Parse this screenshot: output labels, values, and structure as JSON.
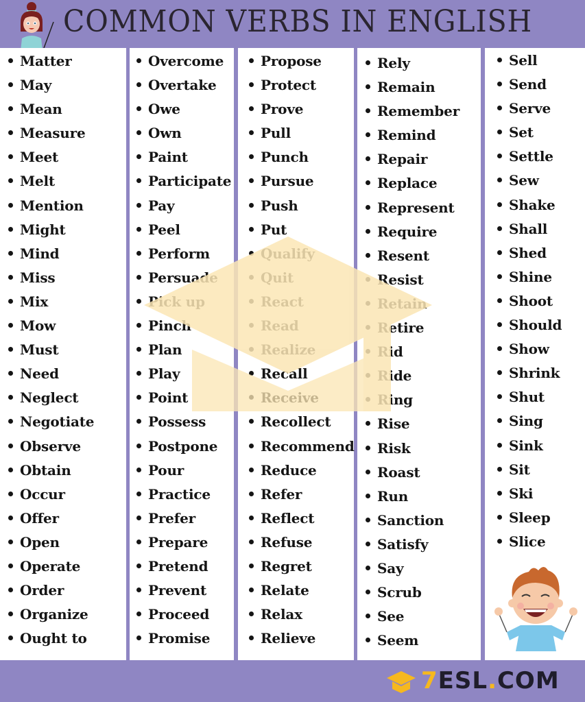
{
  "header": {
    "title": "COMMON VERBS IN ENGLISH",
    "illustration": "teacher-with-pointer"
  },
  "colors": {
    "frame": "#8f86c3",
    "panel": "#ffffff",
    "text": "#151515",
    "title": "#2a2530",
    "watermark": "#fbe6b5",
    "logo_accent": "#f6b81f",
    "logo_dark": "#1f1d2b"
  },
  "columns": [
    {
      "items": [
        "Matter",
        "May",
        "Mean",
        "Measure",
        "Meet",
        "Melt",
        "Mention",
        "Might",
        "Mind",
        "Miss",
        "Mix",
        "Mow",
        "Must",
        "Need",
        "Neglect",
        "Negotiate",
        "Observe",
        "Obtain",
        "Occur",
        "Offer",
        "Open",
        "Operate",
        "Order",
        "Organize",
        "Ought to"
      ]
    },
    {
      "items": [
        "Overcome",
        "Overtake",
        "Owe",
        "Own",
        "Paint",
        "Participate",
        "Pay",
        "Peel",
        "Perform",
        "Persuade",
        "Pick up",
        "Pinch",
        "Plan",
        "Play",
        "Point",
        "Possess",
        "Postpone",
        "Pour",
        "Practice",
        "Prefer",
        "Prepare",
        "Pretend",
        "Prevent",
        "Proceed",
        "Promise"
      ]
    },
    {
      "items": [
        "Propose",
        "Protect",
        "Prove",
        "Pull",
        "Punch",
        "Pursue",
        "Push",
        "Put",
        "Qualify",
        "Quit",
        "React",
        "Read",
        "Realize",
        "Recall",
        "Receive",
        "Recollect",
        "Recommend",
        "Reduce",
        "Refer",
        "Reflect",
        "Refuse",
        "Regret",
        "Relate",
        "Relax",
        "Relieve"
      ]
    },
    {
      "items": [
        "Rely",
        "Remain",
        "Remember",
        "Remind",
        "Repair",
        "Replace",
        "Represent",
        "Require",
        "Resent",
        "Resist",
        "Retain",
        "Retire",
        "Rid",
        "Ride",
        "Ring",
        "Rise",
        "Risk",
        "Roast",
        "Run",
        "Sanction",
        "Satisfy",
        "Say",
        "Scrub",
        "See",
        "Seem"
      ]
    },
    {
      "items": [
        "Sell",
        "Send",
        "Serve",
        "Set",
        "Settle",
        "Sew",
        "Shake",
        "Shall",
        "Shed",
        "Shine",
        "Shoot",
        "Should",
        "Show",
        "Shrink",
        "Shut",
        "Sing",
        "Sink",
        "Sit",
        "Ski",
        "Sleep",
        "Slice"
      ]
    }
  ],
  "footer": {
    "logo_icon": "graduation-cap-icon",
    "logo_prefix": "7",
    "logo_main": "ESL",
    "logo_dot": ".",
    "logo_suffix": "COM"
  }
}
